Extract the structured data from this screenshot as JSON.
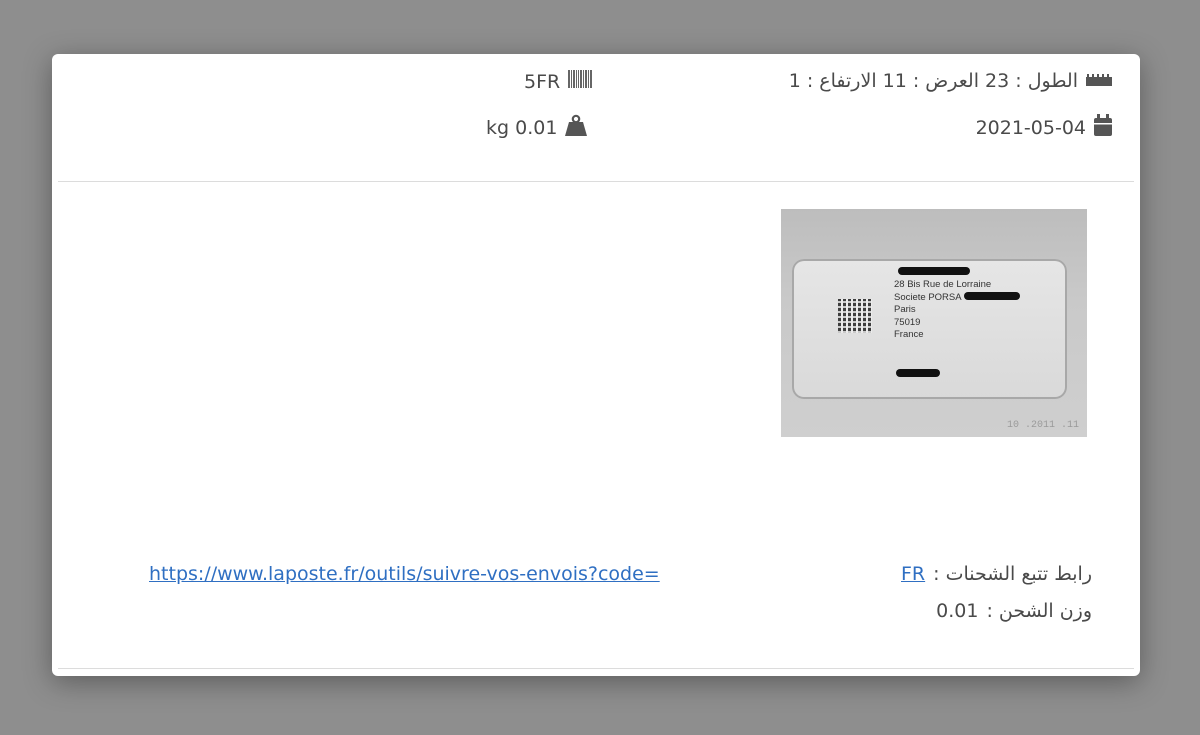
{
  "header": {
    "dimensions_text": "الطول : 23 العرض : 11 الارتفاع : 1",
    "dimensions_icon": "ruler-icon",
    "barcode_text": "5FR",
    "barcode_icon": "barcode-icon",
    "date_text": "2021-05-04",
    "date_icon": "calendar-icon",
    "weight_text": "kg 0.01",
    "weight_icon": "weight-icon"
  },
  "photo": {
    "address_lines": [
      "28 Bis Rue de Lorraine",
      "Societe PORSA",
      "Paris",
      "75019",
      "France"
    ],
    "stamp_text": "10 .2011 .11"
  },
  "details": {
    "tracking_label": "رابط تتبع الشحنات :",
    "tracking_code": "FR",
    "tracking_url": "https://www.laposte.fr/outils/suivre-vos-envois?code=",
    "weight_label": "وزن الشحن :",
    "weight_value": "0.01"
  }
}
